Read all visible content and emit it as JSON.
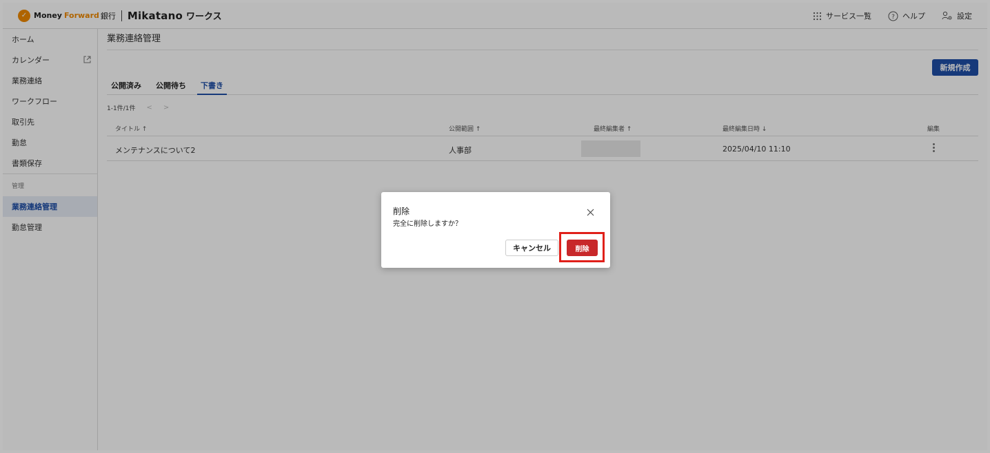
{
  "header": {
    "logo_money": "Money",
    "logo_forward": "Forward",
    "logo_bank": "銀行",
    "logo_mikatano": "Mikatano",
    "logo_works": "ワークス",
    "services_label": "サービス一覧",
    "help_label": "ヘルプ",
    "settings_label": "設定"
  },
  "sidebar": {
    "items": [
      {
        "label": "ホーム"
      },
      {
        "label": "カレンダー"
      },
      {
        "label": "業務連絡"
      },
      {
        "label": "ワークフロー"
      },
      {
        "label": "取引先"
      },
      {
        "label": "勤怠"
      },
      {
        "label": "書類保存"
      }
    ],
    "section_label": "管理",
    "admin_items": [
      {
        "label": "業務連絡管理"
      },
      {
        "label": "勤怠管理"
      }
    ]
  },
  "main": {
    "title": "業務連絡管理",
    "new_button": "新規作成",
    "tabs": [
      {
        "label": "公開済み"
      },
      {
        "label": "公開待ち"
      },
      {
        "label": "下書き"
      }
    ],
    "pager": "1-1件/1件",
    "columns": {
      "title": "タイトル ↑",
      "scope": "公開範囲 ↑",
      "editor": "最終編集者 ↑",
      "edited_at": "最終編集日時 ↓",
      "edit": "編集"
    },
    "rows": [
      {
        "title": "メンテナンスについて2",
        "scope": "人事部",
        "edited_at": "2025/04/10 11:10"
      }
    ]
  },
  "dialog": {
    "title": "削除",
    "message": "完全に削除しますか？",
    "cancel_label": "キャンセル",
    "delete_label": "削除"
  },
  "colors": {
    "primary": "#1f4fa8",
    "danger": "#c8282a",
    "highlight": "#e0201a",
    "brand_orange": "#f08a00"
  }
}
